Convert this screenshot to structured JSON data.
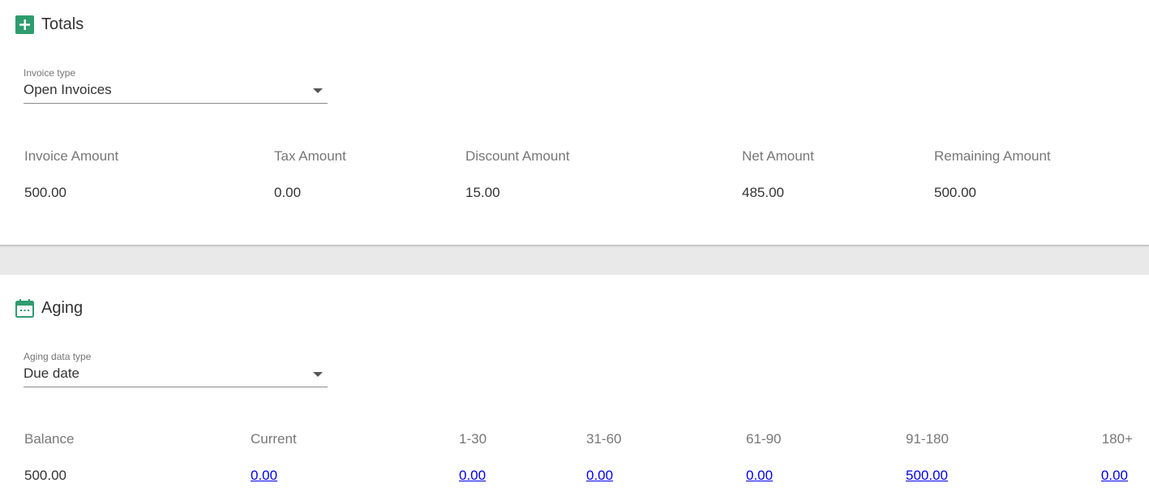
{
  "totals": {
    "title": "Totals",
    "icon": "plus-square-icon",
    "icon_color": "#2e9c6e",
    "invoice_type": {
      "label": "Invoice type",
      "value": "Open Invoices"
    },
    "columns": [
      {
        "header": "Invoice Amount",
        "value": "500.00"
      },
      {
        "header": "Tax Amount",
        "value": "0.00"
      },
      {
        "header": "Discount Amount",
        "value": "15.00"
      },
      {
        "header": "Net Amount",
        "value": "485.00"
      },
      {
        "header": "Remaining Amount",
        "value": "500.00"
      }
    ]
  },
  "aging": {
    "title": "Aging",
    "icon": "calendar-icon",
    "icon_color": "#2e9c6e",
    "aging_data_type": {
      "label": "Aging data type",
      "value": "Due date"
    },
    "columns": [
      {
        "header": "Balance",
        "value": "500.00"
      },
      {
        "header": "Current",
        "value": "0.00"
      },
      {
        "header": "1-30",
        "value": "0.00"
      },
      {
        "header": "31-60",
        "value": "0.00"
      },
      {
        "header": "61-90",
        "value": "0.00"
      },
      {
        "header": "91-180",
        "value": "500.00"
      },
      {
        "header": "180+",
        "value": "0.00"
      }
    ]
  }
}
